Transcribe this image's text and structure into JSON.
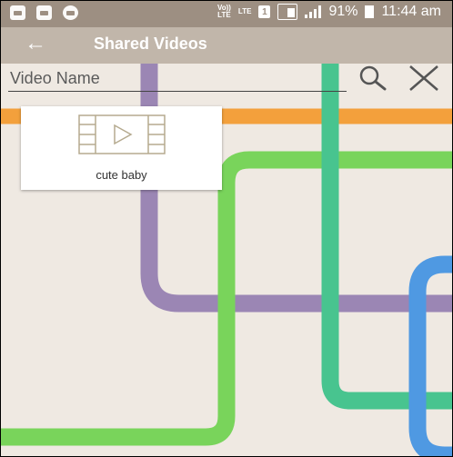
{
  "statusbar": {
    "volte_label": "Vo))\nLTE",
    "lte_label": "LTE",
    "sim_number": "1",
    "battery_percent": "91%",
    "time": "11:44 am"
  },
  "appbar": {
    "title": "Shared Videos",
    "back_icon": "arrow-left-icon"
  },
  "search": {
    "placeholder": "Video Name",
    "value": "",
    "search_icon": "search-icon",
    "close_icon": "close-icon"
  },
  "videos": [
    {
      "name": "cute baby",
      "icon": "film-strip-play-icon"
    }
  ],
  "colors": {
    "statusbar": "#9d8f82",
    "appbar": "#c1b6aa",
    "background": "#efe9e2",
    "line_purple": "#9b86b4",
    "line_teal": "#48c48f",
    "line_orange": "#f3a03c",
    "line_green": "#79d45b",
    "line_blue": "#4f99e2"
  }
}
